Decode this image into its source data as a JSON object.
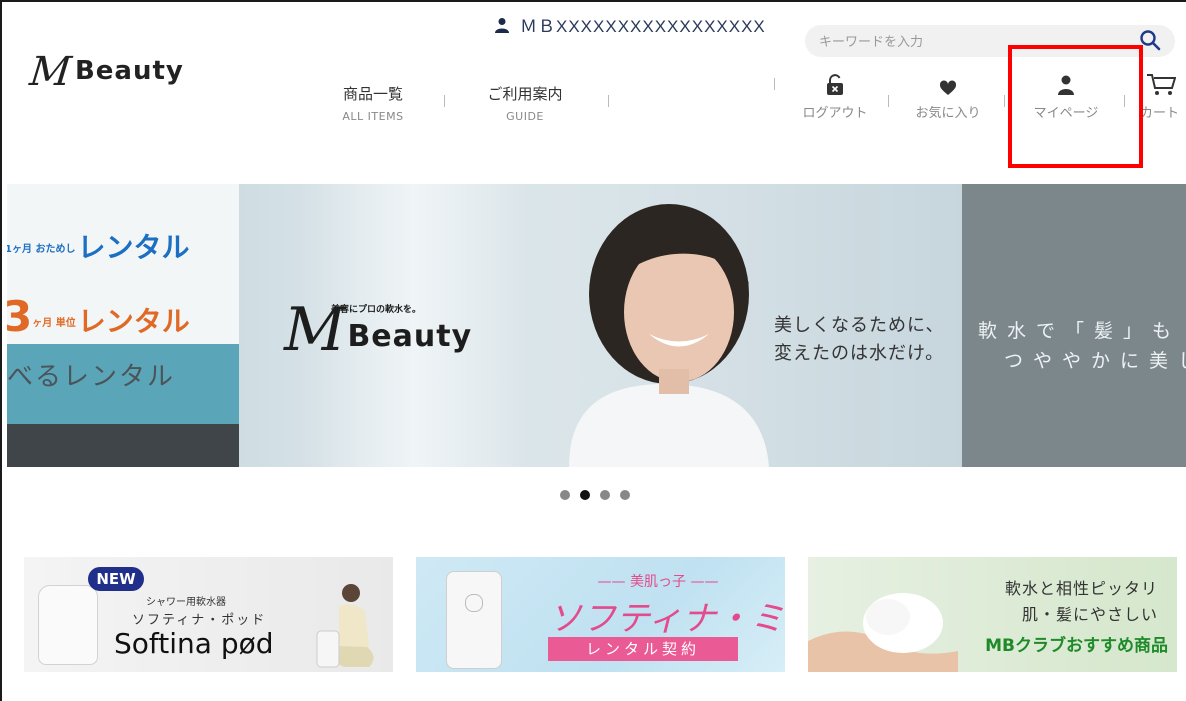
{
  "header": {
    "logo": {
      "mark": "M",
      "text": "Beauty"
    },
    "member": {
      "id": "ＭＢXXXXXXXXXXXXXXXXX"
    },
    "search": {
      "placeholder": "キーワードを入力"
    },
    "nav": [
      {
        "jp": "商品一覧",
        "en": "ALL ITEMS"
      },
      {
        "jp": "ご利用案内",
        "en": "GUIDE"
      }
    ],
    "utils": [
      {
        "label": "ログアウト",
        "icon": "unlock-icon"
      },
      {
        "label": "お気に入り",
        "icon": "heart-icon"
      },
      {
        "label": "マイページ",
        "icon": "user-icon"
      },
      {
        "label": "カート",
        "icon": "cart-icon"
      }
    ],
    "highlight_color": "#ff0000"
  },
  "hero": {
    "left_slide": {
      "line1_small": "1ヶ月 おためし",
      "line1": "レンタル",
      "line2_num": "3",
      "line2_small": "ヶ月 単位",
      "line2": "レンタル",
      "line3": "べるレンタル"
    },
    "main_slide": {
      "tagline": "美容にプロの軟水を。",
      "logo_mark": "M",
      "logo_text": "Beauty",
      "copy_line1": "美しくなるために、",
      "copy_line2": "変えたのは水だけ。"
    },
    "right_slide": {
      "copy_line1": "軟水で「髪」も",
      "copy_line2": "つややかに美し"
    },
    "dots": {
      "count": 4,
      "active": 1
    }
  },
  "banners": [
    {
      "badge": "NEW",
      "sub1": "シャワー用軟水器",
      "sub2": "ソフティナ・ポッド",
      "title": "Softina pød"
    },
    {
      "head": "—— 美肌っ子 ——",
      "title": "ソフティナ・ミニ",
      "pill": "レンタル契約"
    },
    {
      "line1": "軟水と相性ピッタリ",
      "line2": "肌・髪にやさしい",
      "line3": "MBクラブおすすめ商品"
    }
  ],
  "colors": {
    "accent_red": "#ff0000",
    "navy": "#1f2f8a",
    "pink": "#e34b8c",
    "green": "#1f8a2a",
    "teal": "#5aa6b8"
  }
}
